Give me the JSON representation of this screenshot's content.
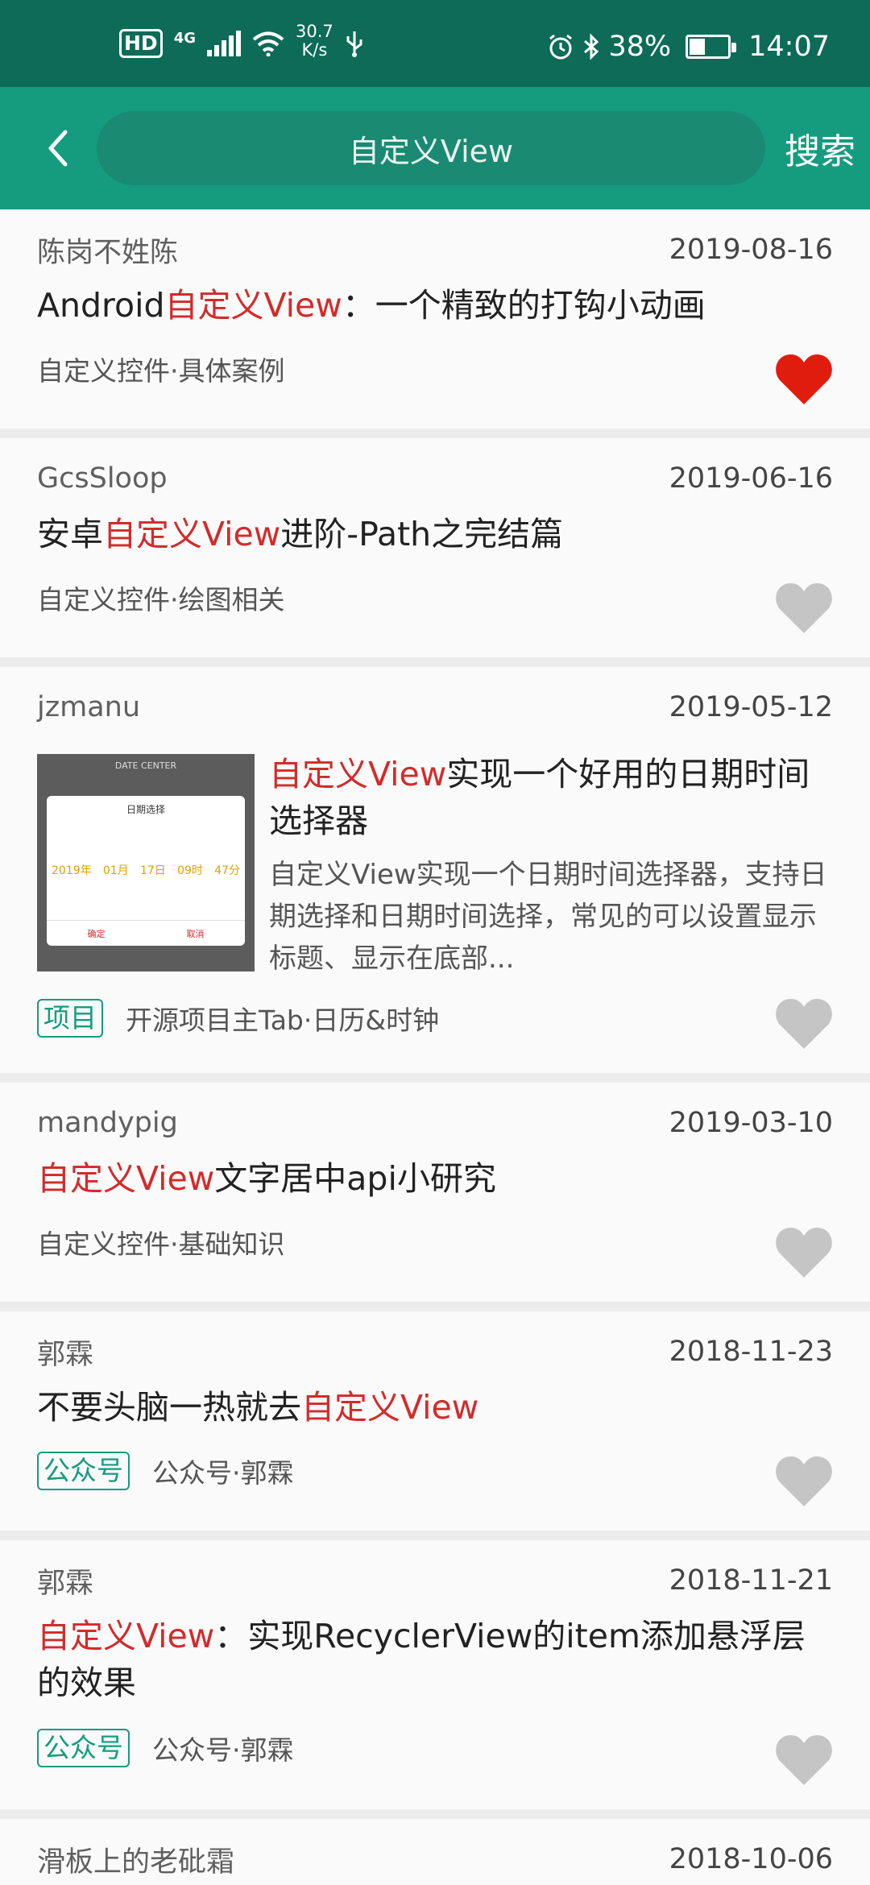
{
  "status_bar": {
    "hd": "HD",
    "network": "4G",
    "speed_value": "30.7",
    "speed_unit": "K/s",
    "battery": "38%",
    "time": "14:07"
  },
  "toolbar": {
    "search_value": "自定义View",
    "search_button": "搜索",
    "colors": {
      "primary": "#159c7e",
      "status": "#0d6b58"
    }
  },
  "articles": [
    {
      "author": "陈岗不姓陈",
      "date": "2019-08-16",
      "title_parts": [
        "Android",
        "自定义View",
        "：一个精致的打钩小动画"
      ],
      "chapter": "自定义控件·具体案例",
      "liked": true
    },
    {
      "author": "GcsSloop",
      "date": "2019-06-16",
      "title_parts": [
        "安卓",
        "自定义View",
        "进阶-Path之完结篇"
      ],
      "chapter": "自定义控件·绘图相关",
      "liked": false
    },
    {
      "author": "jzmanu",
      "date": "2019-05-12",
      "title_parts": [
        "",
        "自定义View",
        "实现一个好用的日期时间选择器"
      ],
      "desc": "自定义View实现一个日期时间选择器，支持日期选择和日期时间选择，常见的可以设置显示标题、显示在底部...",
      "tag": "项目",
      "chapter": "开源项目主Tab·日历&时钟",
      "liked": false,
      "thumb": {
        "title": "DATE CENTER",
        "panel_title": "日期选择",
        "values": [
          "2019年",
          "01月",
          "17日",
          "09时",
          "47分"
        ],
        "confirm": "确定",
        "cancel": "取消"
      }
    },
    {
      "author": "mandypig",
      "date": "2019-03-10",
      "title_parts": [
        "",
        "自定义View",
        "文字居中api小研究"
      ],
      "chapter": "自定义控件·基础知识",
      "liked": false
    },
    {
      "author": "郭霖",
      "date": "2018-11-23",
      "title_parts": [
        "不要头脑一热就去",
        "自定义View",
        ""
      ],
      "tag": "公众号",
      "chapter": "公众号·郭霖",
      "liked": false
    },
    {
      "author": "郭霖",
      "date": "2018-11-21",
      "title_parts": [
        "",
        "自定义View",
        "：实现RecyclerView的item添加悬浮层的效果"
      ],
      "tag": "公众号",
      "chapter": "公众号·郭霖",
      "liked": false
    },
    {
      "author": "滑板上的老砒霜",
      "date": "2018-10-06"
    }
  ]
}
